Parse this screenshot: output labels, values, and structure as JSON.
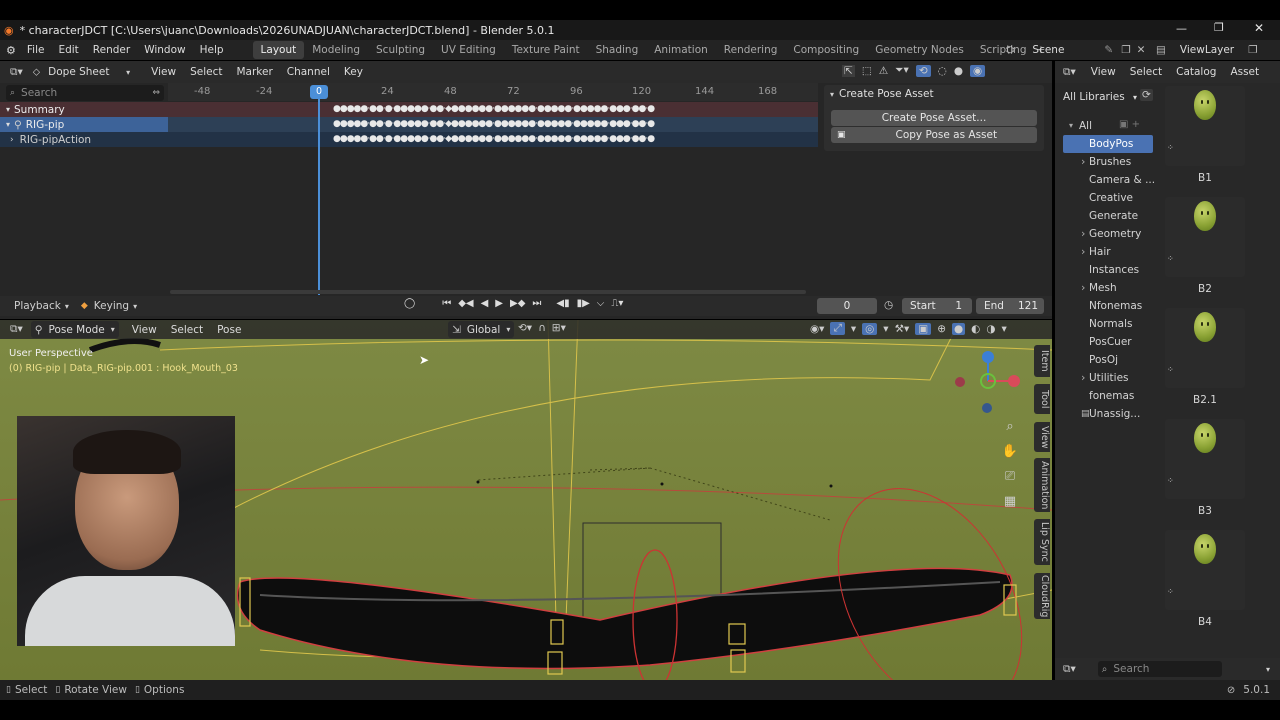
{
  "window": {
    "title": "* characterJDCT [C:\\Users\\juanc\\Downloads\\2026UNADJUAN\\characterJDCT.blend] - Blender 5.0.1"
  },
  "menus": [
    "File",
    "Edit",
    "Render",
    "Window",
    "Help"
  ],
  "workspaces": [
    "Layout",
    "Modeling",
    "Sculpting",
    "UV Editing",
    "Texture Paint",
    "Shading",
    "Animation",
    "Rendering",
    "Compositing",
    "Geometry Nodes",
    "Scripting"
  ],
  "scene": "Scene",
  "view_layer": "ViewLayer",
  "dopesheet": {
    "mode": "Dope Sheet",
    "menus": [
      "View",
      "Select",
      "Marker",
      "Channel",
      "Key"
    ],
    "search_placeholder": "Search",
    "frame_ticks": [
      "-48",
      "-24",
      "0",
      "24",
      "48",
      "72",
      "96",
      "120",
      "144",
      "168"
    ],
    "current_frame": "0",
    "channels": [
      "Summary",
      "RIG-pip",
      "RIG-pipAction"
    ]
  },
  "pose_asset": {
    "header": "Create Pose Asset",
    "create_btn": "Create Pose Asset...",
    "copy_btn": "Copy Pose as Asset"
  },
  "playback": {
    "playback": "Playback",
    "keying": "Keying",
    "frame": "0",
    "start_label": "Start",
    "start": "1",
    "end_label": "End",
    "end": "121"
  },
  "viewport": {
    "mode": "Pose Mode",
    "menus": [
      "View",
      "Select",
      "Pose"
    ],
    "orientation": "Global",
    "perspective": "User Perspective",
    "info": "(0) RIG-pip | Data_RIG-pip.001 : Hook_Mouth_03",
    "tabs": [
      "Item",
      "Tool",
      "View",
      "Animation",
      "Lip Sync",
      "CloudRig"
    ]
  },
  "asset_browser": {
    "menus": [
      "View",
      "Select",
      "Catalog",
      "Asset"
    ],
    "library": "All Libraries",
    "catalogs": [
      {
        "label": "All",
        "expand": "open"
      },
      {
        "label": "BodyPos",
        "expand": "",
        "selected": true
      },
      {
        "label": "Brushes",
        "expand": "closed"
      },
      {
        "label": "Camera & ...",
        "expand": ""
      },
      {
        "label": "Creative",
        "expand": ""
      },
      {
        "label": "Generate",
        "expand": ""
      },
      {
        "label": "Geometry",
        "expand": "closed"
      },
      {
        "label": "Hair",
        "expand": "closed"
      },
      {
        "label": "Instances",
        "expand": ""
      },
      {
        "label": "Mesh",
        "expand": "closed"
      },
      {
        "label": "Nfonemas",
        "expand": ""
      },
      {
        "label": "Normals",
        "expand": ""
      },
      {
        "label": "PosCuer",
        "expand": ""
      },
      {
        "label": "PosOj",
        "expand": ""
      },
      {
        "label": "Utilities",
        "expand": "closed"
      },
      {
        "label": "fonemas",
        "expand": ""
      },
      {
        "label": "Unassig...",
        "expand": ""
      }
    ],
    "assets": [
      "B1",
      "B2",
      "B2.1",
      "B3",
      "B4"
    ],
    "search_placeholder": "Search"
  },
  "status": {
    "select": "Select",
    "rotate": "Rotate View",
    "options": "Options",
    "version": "5.0.1"
  }
}
